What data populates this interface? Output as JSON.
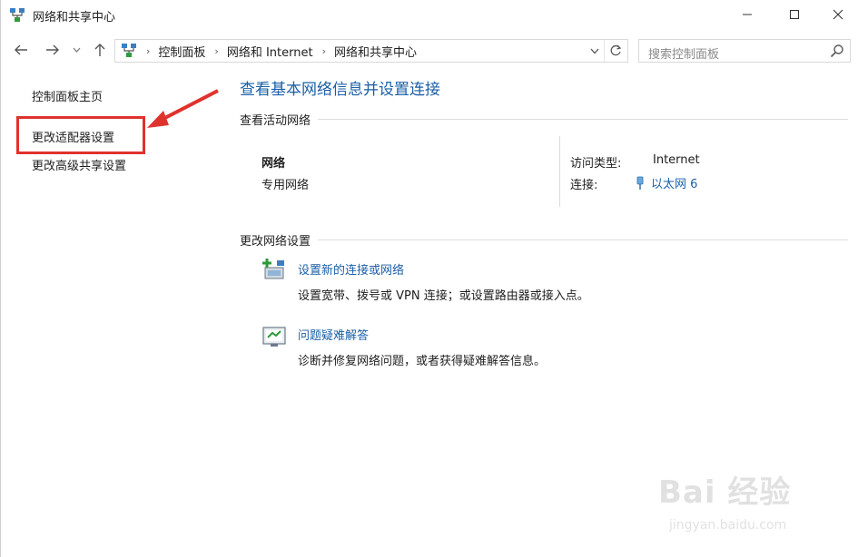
{
  "window": {
    "title": "网络和共享中心",
    "icon": "network-icon"
  },
  "address_bar": {
    "breadcrumbs": [
      "控制面板",
      "网络和 Internet",
      "网络和共享中心"
    ],
    "search_placeholder": "搜索控制面板"
  },
  "left_pane": {
    "links": [
      "控制面板主页",
      "更改适配器设置",
      "更改高级共享设置"
    ],
    "highlighted_link": "更改适配器设置",
    "annotation_color": "#e0322d"
  },
  "main": {
    "title": "查看基本网络信息并设置连接",
    "active_networks_heading": "查看活动网络",
    "network": {
      "name": "网络",
      "category": "专用网络",
      "access_type_label": "访问类型:",
      "access_type_value": "Internet",
      "connections_label": "连接:",
      "connection_value": "以太网 6"
    },
    "change_settings_heading": "更改网络设置",
    "tasks": [
      {
        "icon": "new-connection-icon",
        "link": "设置新的连接或网络",
        "desc": "设置宽带、拨号或 VPN 连接；或设置路由器或接入点。"
      },
      {
        "icon": "troubleshoot-icon",
        "link": "问题疑难解答",
        "desc": "诊断并修复网络问题，或者获得疑难解答信息。"
      }
    ]
  },
  "watermark": {
    "brand": "Bai 经验",
    "url": "jingyan.baidu.com"
  },
  "colors": {
    "link": "#1a5fa8",
    "annotation": "#e0322d"
  }
}
